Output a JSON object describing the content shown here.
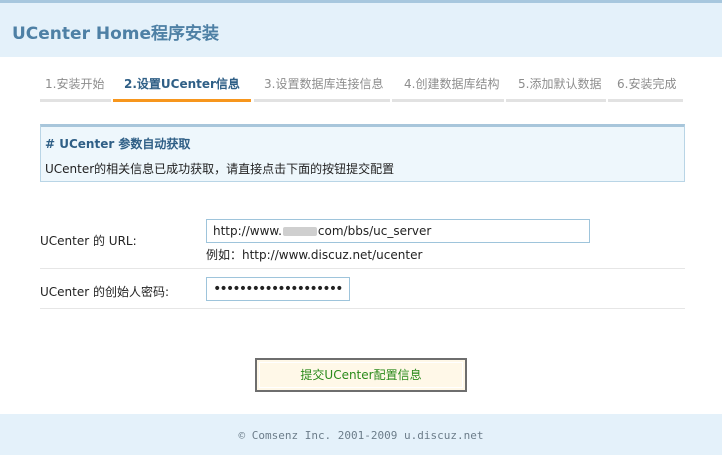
{
  "header": {
    "title": "UCenter Home程序安装"
  },
  "steps": [
    {
      "label": "1.安装开始",
      "active": false
    },
    {
      "label": "2.设置UCenter信息",
      "active": true
    },
    {
      "label": "3.设置数据库连接信息",
      "active": false
    },
    {
      "label": "4.创建数据库结构",
      "active": false
    },
    {
      "label": "5.添加默认数据",
      "active": false
    },
    {
      "label": "6.安装完成",
      "active": false
    }
  ],
  "info": {
    "title": "# UCenter 参数自动获取",
    "text": "UCenter的相关信息已成功获取，请直接点击下面的按钮提交配置"
  },
  "form": {
    "url_label": "UCenter 的 URL:",
    "url_value_prefix": "http://www.",
    "url_value_suffix": "com/bbs/uc_server",
    "url_hint": "例如：http://www.discuz.net/ucenter",
    "password_label": "UCenter 的创始人密码:",
    "password_value": "••••••••••••••••••••"
  },
  "submit": {
    "label": "提交UCenter配置信息"
  },
  "footer": {
    "text": "© Comsenz Inc. 2001-2009 u.discuz.net"
  }
}
